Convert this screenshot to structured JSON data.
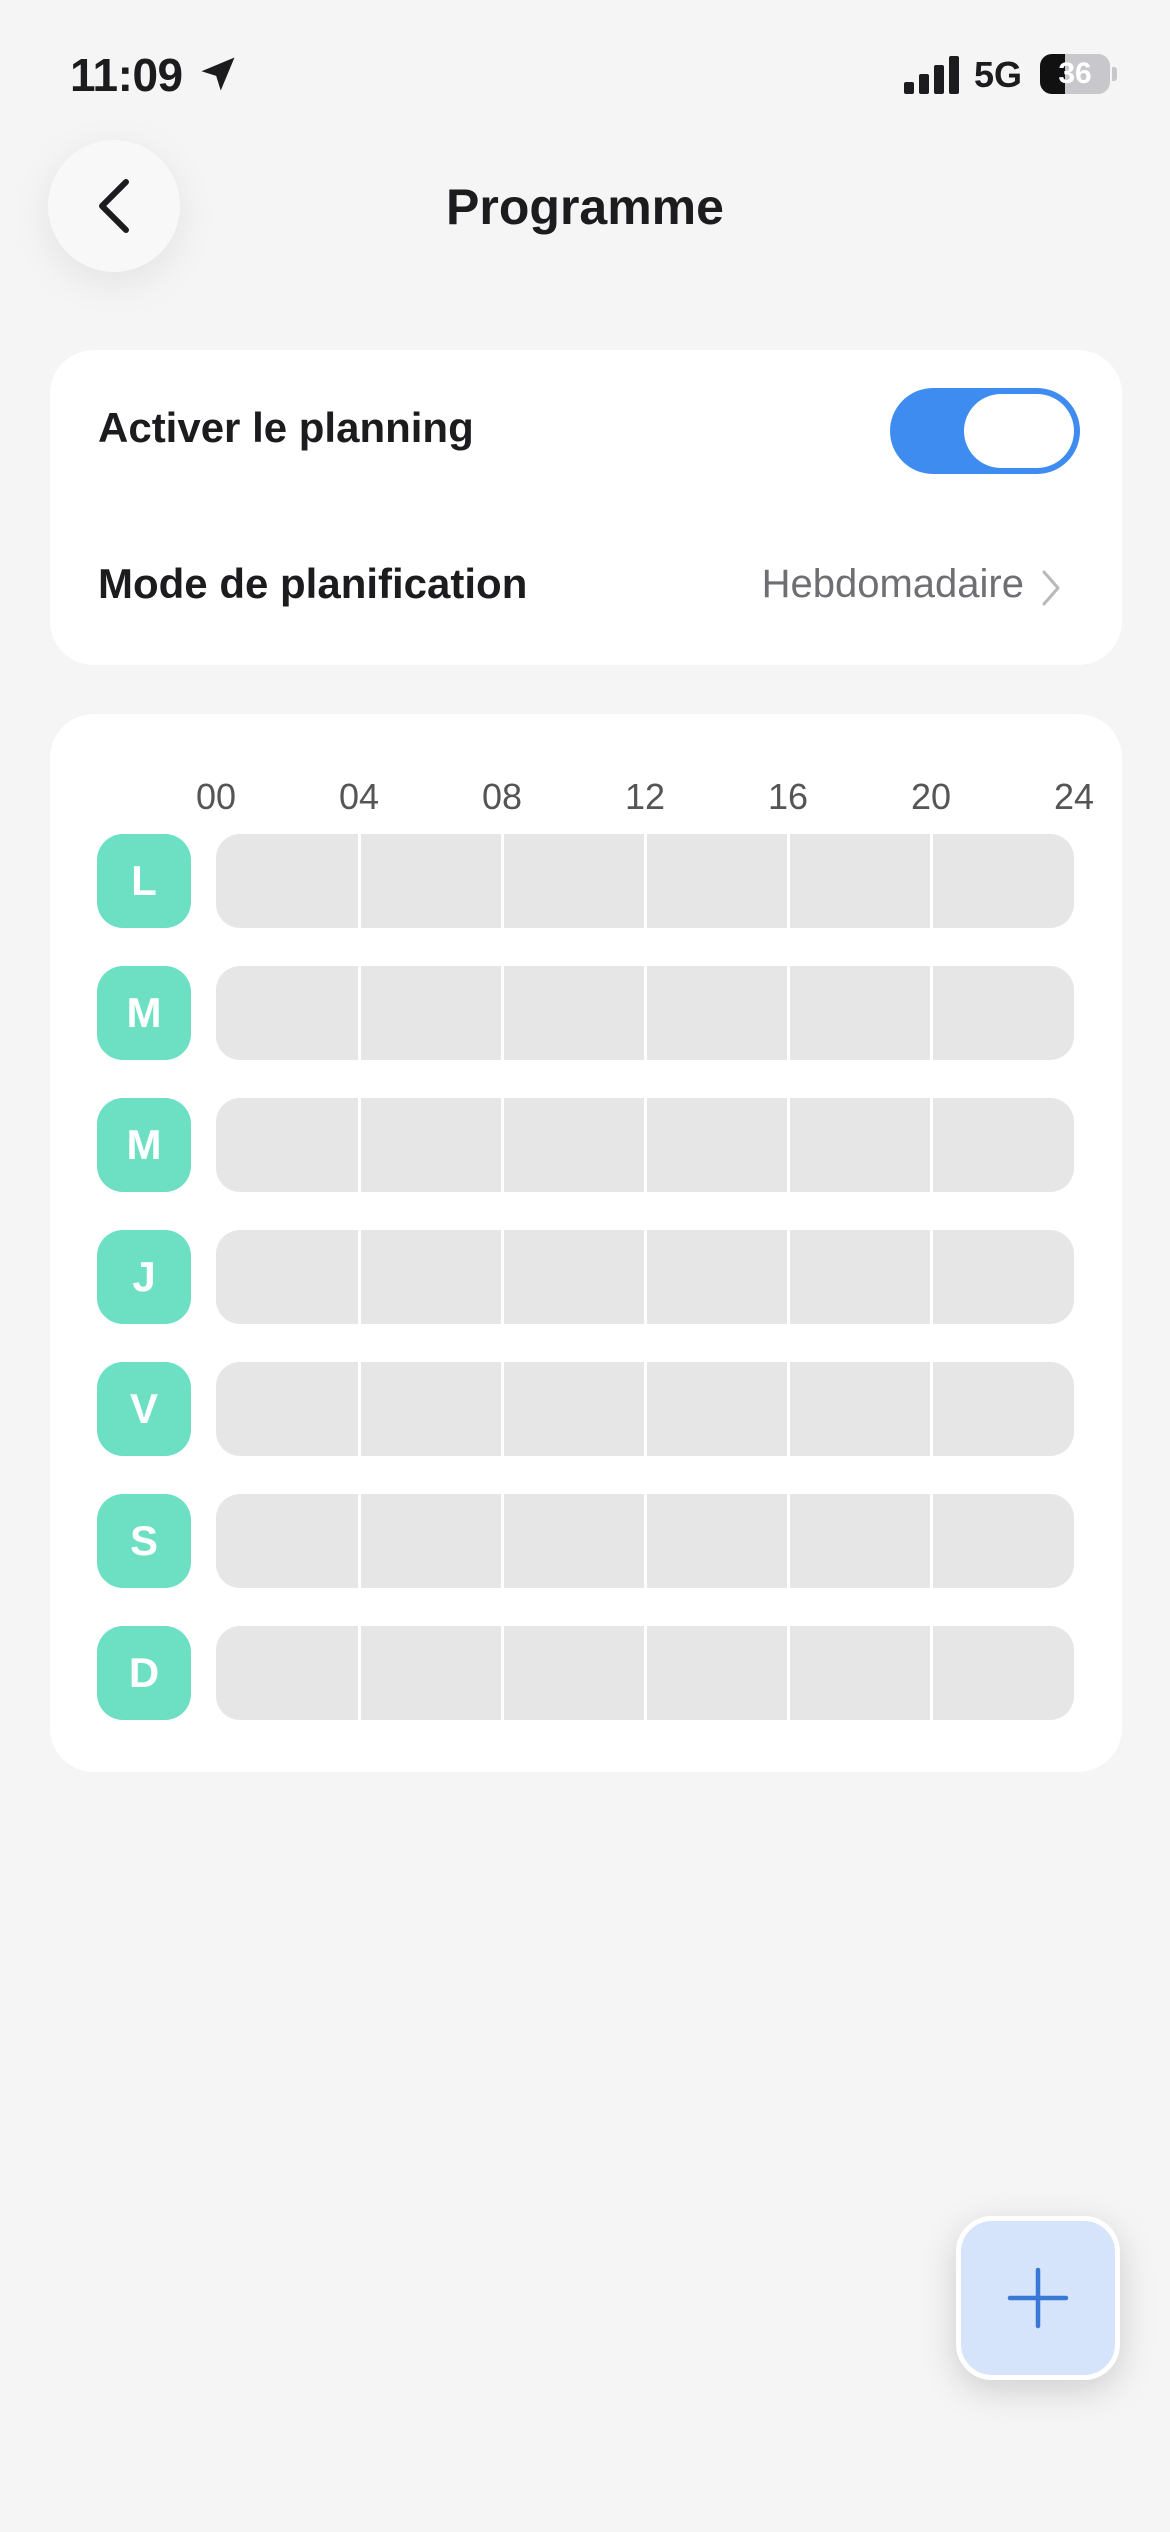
{
  "status_bar": {
    "time": "11:09",
    "network": "5G",
    "battery_percent": "36",
    "battery_level": 0.36
  },
  "header": {
    "title": "Programme"
  },
  "settings": {
    "planning_label": "Activer le planning",
    "planning_enabled": true,
    "mode_label": "Mode de planification",
    "mode_value": "Hebdomadaire"
  },
  "schedule": {
    "hours": [
      "00",
      "04",
      "08",
      "12",
      "16",
      "20",
      "24"
    ],
    "days": [
      "L",
      "M",
      "M",
      "J",
      "V",
      "S",
      "D"
    ]
  },
  "colors": {
    "accent_toggle": "#3f8cf0",
    "day_badge": "#6de0c4",
    "track": "#e6e6e6",
    "add_button": "#d5e3fb",
    "add_icon": "#3a78d6"
  },
  "icons": {
    "back": "chevron-left-icon",
    "location": "location-arrow-icon",
    "signal": "signal-bars-icon",
    "mode_chevron": "chevron-right-icon",
    "add": "plus-icon"
  }
}
